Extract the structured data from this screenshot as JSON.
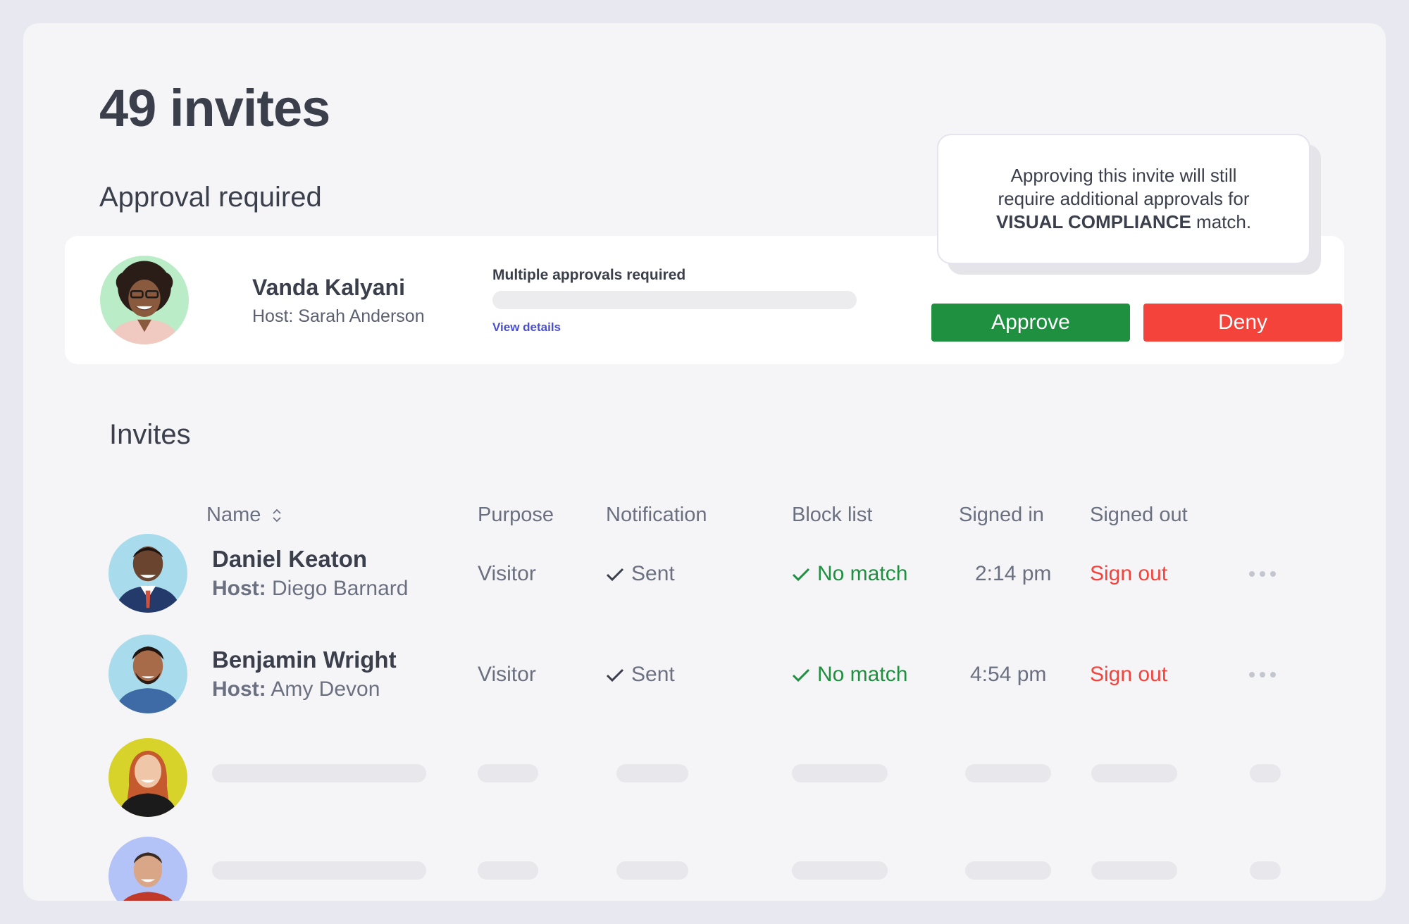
{
  "header": {
    "title": "49 invites"
  },
  "approval": {
    "section_title": "Approval required",
    "card": {
      "name": "Vanda Kalyani",
      "host": "Host: Sarah Anderson",
      "status_label": "Multiple approvals required",
      "progress": 0,
      "view_details": "View details",
      "approve_label": "Approve",
      "deny_label": "Deny"
    },
    "tooltip": {
      "line1": "Approving this invite will still",
      "line2": "require additional approvals for",
      "emphasis": "VISUAL COMPLIANCE",
      "tail": " match."
    }
  },
  "invites": {
    "section_title": "Invites",
    "columns": {
      "name": "Name",
      "purpose": "Purpose",
      "notification": "Notification",
      "block_list": "Block list",
      "signed_in": "Signed in",
      "signed_out": "Signed out"
    },
    "rows": [
      {
        "name": "Daniel Keaton",
        "host_label": "Host:",
        "host_name": " Diego Barnard",
        "purpose": "Visitor",
        "notification": "Sent",
        "block_list": "No match",
        "signed_in": "2:14 pm",
        "signed_out": "Sign out"
      },
      {
        "name": "Benjamin Wright",
        "host_label": "Host:",
        "host_name": " Amy Devon",
        "purpose": "Visitor",
        "notification": "Sent",
        "block_list": "No match",
        "signed_in": "4:54 pm",
        "signed_out": "Sign out"
      }
    ]
  },
  "icons": {
    "sort": "sort-icon",
    "check": "check-icon",
    "more": "more-icon"
  },
  "colors": {
    "approve": "#1f8f40",
    "deny": "#f4433b",
    "link": "#4a4fd1",
    "no_match": "#1f8f40",
    "sign_out": "#f4433b"
  }
}
